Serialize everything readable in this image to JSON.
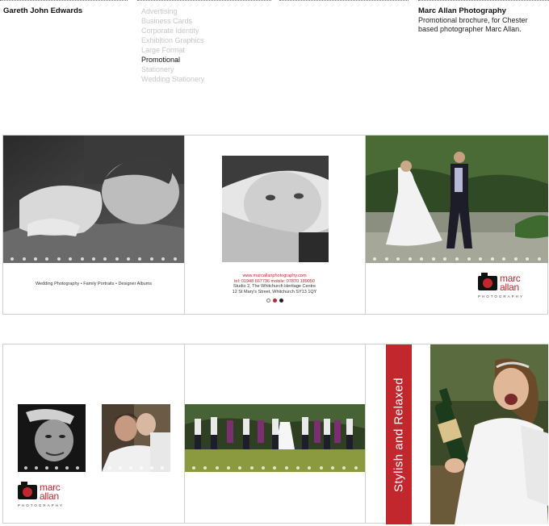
{
  "header": {
    "owner_name": "Gareth John Edwards",
    "categories": [
      {
        "label": "Advertising",
        "active": false
      },
      {
        "label": "Business Cards",
        "active": false
      },
      {
        "label": "Corporate Identity",
        "active": false
      },
      {
        "label": "Exhibition Graphics",
        "active": false
      },
      {
        "label": "Large Format",
        "active": false
      },
      {
        "label": "Promotional",
        "active": true
      },
      {
        "label": "Stationery",
        "active": false
      },
      {
        "label": "Wedding Stationery",
        "active": false
      }
    ],
    "project_title": "Marc Allan Photography",
    "project_description": "Promotional brochure, for Chester based photographer Marc Allan."
  },
  "spread1": {
    "services_text": "Wedding Photography  •  Family Portraits  •  Designer Albums",
    "contact": {
      "website": "www.marcallanphotography.com",
      "phone": "tel: 01948 667736  mobile: 07870 189050",
      "address_1": "Studio 2, The Whitchurch Heritage Centre",
      "address_2": "12 St Mary's Street, Whitchurch SY13 1QY"
    },
    "logo": {
      "line1": "marc",
      "line2": "allan",
      "sub": "PHOTOGRAPHY"
    }
  },
  "spread2": {
    "logo": {
      "line1": "marc",
      "line2": "allan",
      "sub": "PHOTOGRAPHY"
    },
    "slogan": "Stylish and Relaxed"
  },
  "colors": {
    "brand_red": "#c1272d",
    "active_text": "#111111",
    "inactive_text": "#c7c7c7"
  },
  "icons": {
    "logo_mark": "camera-icon"
  }
}
